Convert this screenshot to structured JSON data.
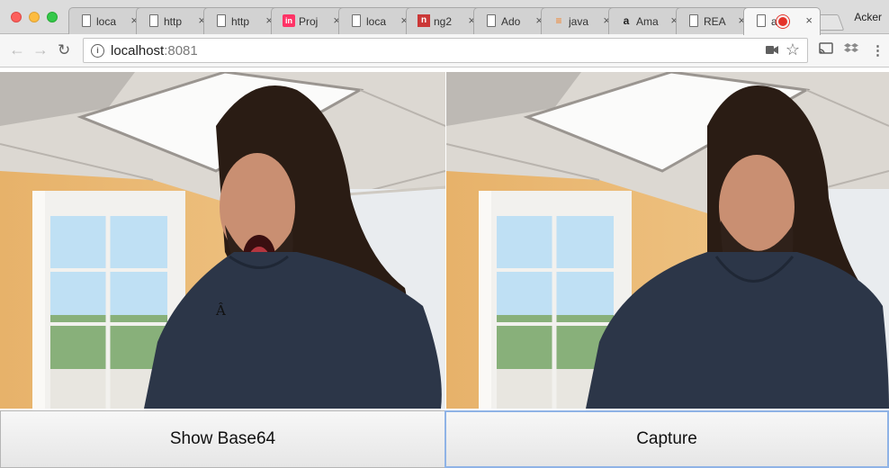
{
  "browser": {
    "profile_name": "Acker",
    "tabs": [
      {
        "title": "loca",
        "icon": "page-icon"
      },
      {
        "title": "http",
        "icon": "page-icon"
      },
      {
        "title": "http",
        "icon": "page-icon"
      },
      {
        "title": "Proj",
        "icon": "invision-icon",
        "icon_text": "in"
      },
      {
        "title": "loca",
        "icon": "page-icon"
      },
      {
        "title": "ng2",
        "icon": "npm-icon",
        "icon_text": "n"
      },
      {
        "title": "Ado",
        "icon": "page-icon"
      },
      {
        "title": "java",
        "icon": "stackoverflow-icon"
      },
      {
        "title": "Ama",
        "icon": "amazon-icon",
        "icon_text": "a"
      },
      {
        "title": "REA",
        "icon": "page-icon"
      },
      {
        "title": "a",
        "icon": "page-icon",
        "active": true,
        "recording": true
      }
    ],
    "close_glyph": "×",
    "url_host": "localhost",
    "url_port": ":8081",
    "info_glyph": "i",
    "star_glyph": "☆"
  },
  "page": {
    "glitch_char": "Â",
    "buttons": {
      "show_base64": "Show Base64",
      "capture": "Capture"
    }
  },
  "colors": {
    "record_red": "#e4332a",
    "capture_focus_border": "#8fb3e6"
  }
}
